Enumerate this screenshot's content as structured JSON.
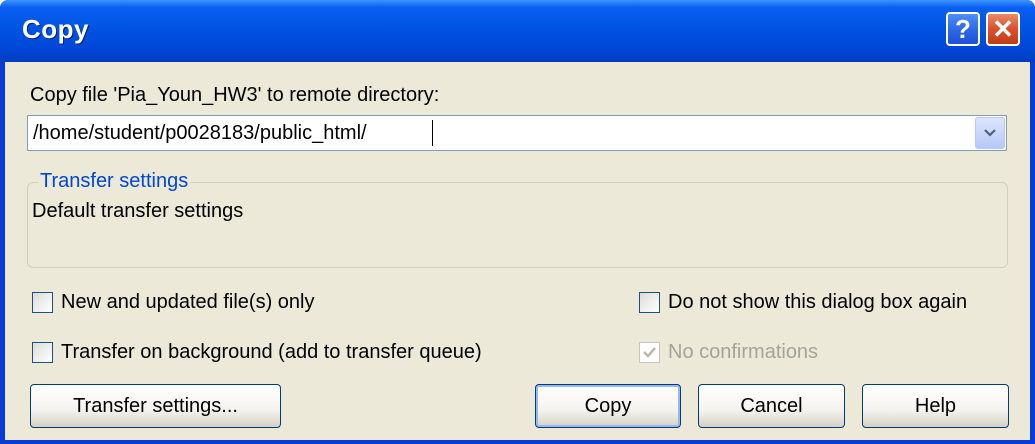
{
  "window": {
    "title": "Copy",
    "help_glyph": "?",
    "close_glyph": "✕"
  },
  "prompt": "Copy file 'Pia_Youn_HW3' to remote directory:",
  "directory": {
    "value": "/home/student/p0028183/public_html/"
  },
  "transfer_group": {
    "title": "Transfer settings",
    "text": "Default transfer settings"
  },
  "options": {
    "new_updated": {
      "label": "New and updated file(s) only",
      "checked": false
    },
    "background": {
      "label": "Transfer on background (add to transfer queue)",
      "checked": false
    },
    "dont_show": {
      "label": "Do not show this dialog box again",
      "checked": false
    },
    "no_confirm": {
      "label": "No confirmations",
      "checked": true,
      "disabled": true
    }
  },
  "buttons": {
    "transfer_settings": "Transfer settings...",
    "copy": "Copy",
    "cancel": "Cancel",
    "help": "Help"
  },
  "colors": {
    "titlebar": "#0054e3",
    "dialog_bg": "#ece9d8",
    "group_title": "#0046d5"
  }
}
